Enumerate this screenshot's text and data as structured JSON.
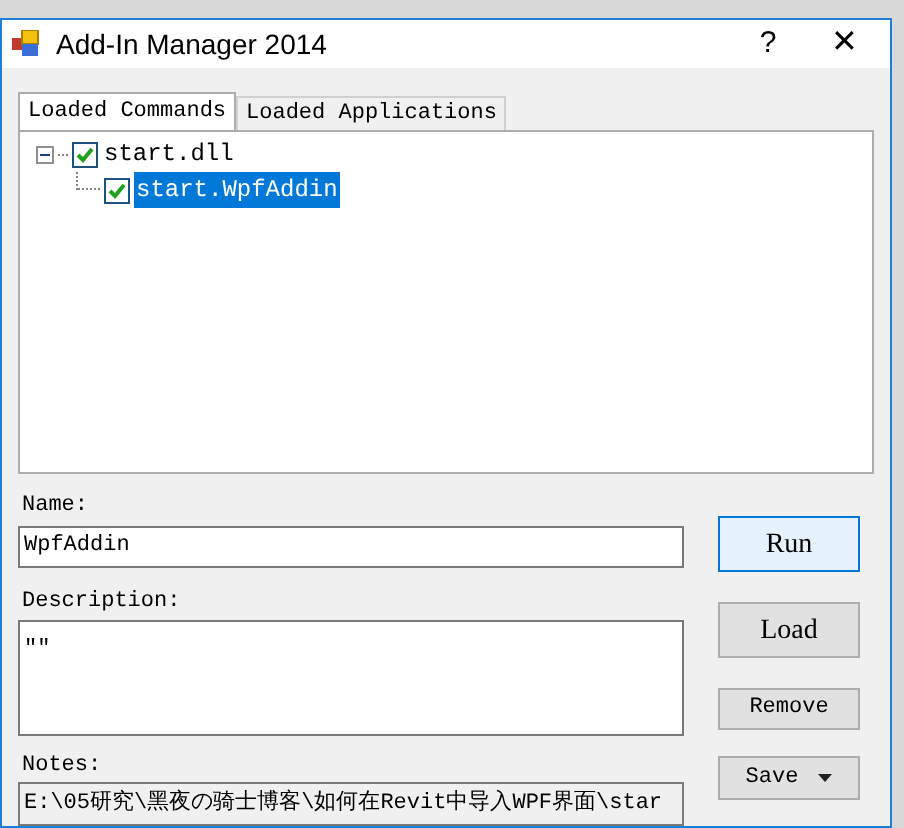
{
  "window": {
    "title": "Add-In Manager 2014",
    "help": "?",
    "close": "✕"
  },
  "tabs": [
    {
      "label": "Loaded Commands",
      "selected": true
    },
    {
      "label": "Loaded Applications",
      "selected": false
    }
  ],
  "tree": [
    {
      "label": "start.dll",
      "checked": true,
      "selected": false,
      "expanded": true,
      "children": [
        {
          "label": "start.WpfAddin",
          "checked": true,
          "selected": true
        }
      ]
    }
  ],
  "name": {
    "label": "Name:",
    "value": "WpfAddin"
  },
  "description": {
    "label": "Description:",
    "value": "\"\""
  },
  "notes": {
    "label": "Notes:",
    "value": "E:\\05研究\\黑夜の骑士博客\\如何在Revit中导入WPF界面\\star"
  },
  "buttons": [
    {
      "label": "Run",
      "kind": "default"
    },
    {
      "label": "Load",
      "kind": "large"
    },
    {
      "label": "Remove",
      "kind": "small"
    },
    {
      "label": "Save",
      "kind": "dropdown"
    }
  ]
}
